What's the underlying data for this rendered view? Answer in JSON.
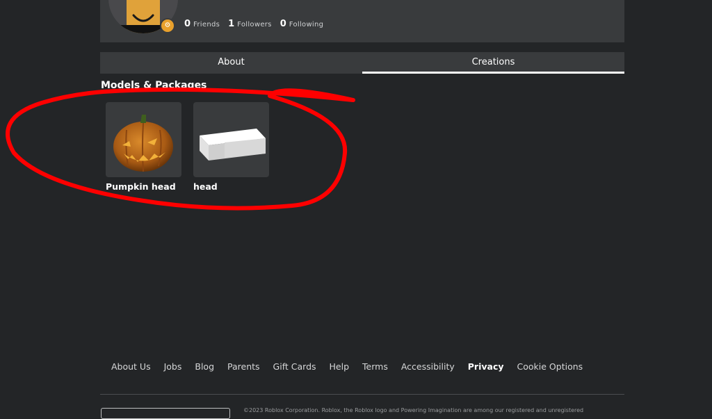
{
  "profile": {
    "stats": [
      {
        "count": "0",
        "label": "Friends"
      },
      {
        "count": "1",
        "label": "Followers"
      },
      {
        "count": "0",
        "label": "Following"
      }
    ]
  },
  "tabs": [
    {
      "label": "About",
      "active": false
    },
    {
      "label": "Creations",
      "active": true
    }
  ],
  "section": {
    "title": "Models & Packages"
  },
  "items": [
    {
      "name": "Pumpkin head",
      "thumbnail": "pumpkin-head-icon"
    },
    {
      "name": "head",
      "thumbnail": "white-block-icon"
    }
  ],
  "annotation": {
    "color": "#ff0000"
  },
  "footer": {
    "links": [
      "About Us",
      "Jobs",
      "Blog",
      "Parents",
      "Gift Cards",
      "Help",
      "Terms",
      "Accessibility",
      "Privacy",
      "Cookie Options"
    ],
    "copyright": "©2023 Roblox Corporation. Roblox, the Roblox logo and Powering Imagination are among our registered and unregistered"
  },
  "colors": {
    "background": "#232527",
    "card": "#393b3d",
    "badge": "#e9a12c"
  }
}
